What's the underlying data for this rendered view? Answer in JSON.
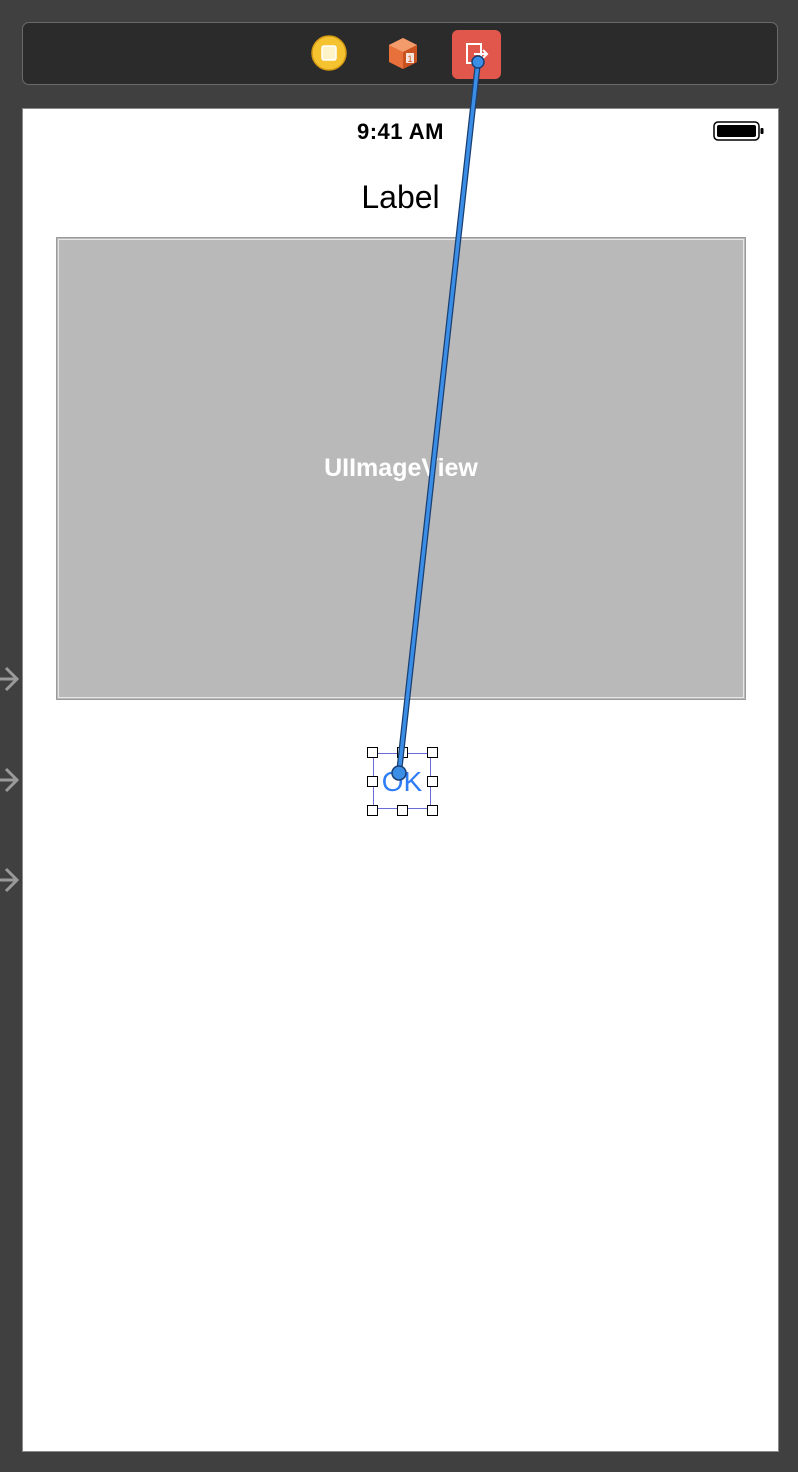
{
  "scene_dock": {
    "items": [
      {
        "name": "View Controller",
        "icon": "view-controller-icon",
        "color": "#f5c330"
      },
      {
        "name": "First Responder",
        "icon": "cube-icon",
        "color": "#e8703a"
      },
      {
        "name": "Exit",
        "icon": "exit-icon",
        "color": "#e2574c"
      }
    ]
  },
  "status_bar": {
    "time": "9:41 AM",
    "battery_icon": "battery-icon"
  },
  "content": {
    "label_text": "Label",
    "image_view_text": "UIImageView",
    "button_text": "OK",
    "button_color": "#2e7df7"
  },
  "canvas": {
    "background": "#404040",
    "connection_color": "#3b8ee5",
    "segue_arrow_icon": "segue-arrow-icon"
  }
}
